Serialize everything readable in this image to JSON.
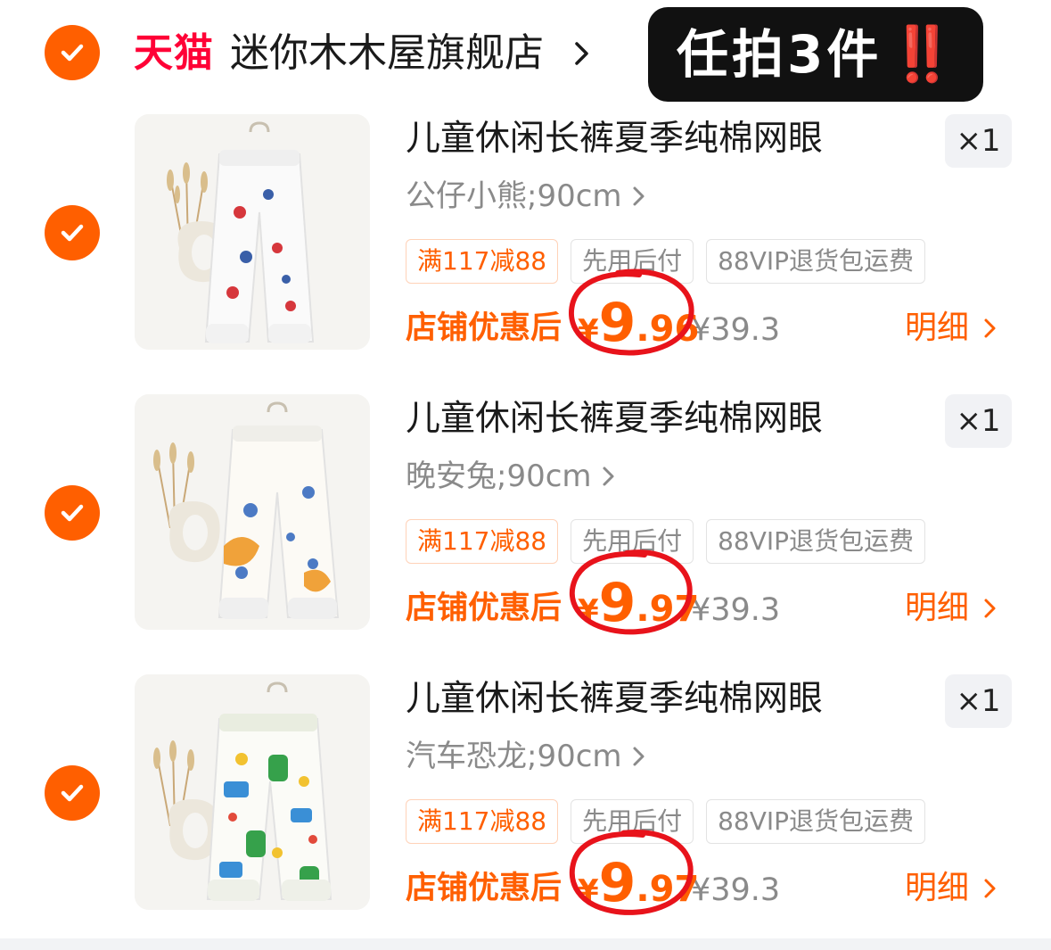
{
  "store": {
    "platform_label": "天猫",
    "name": "迷你木木屋旗舰店",
    "banner_text": "任拍3件",
    "banner_mark": "‼️"
  },
  "items": [
    {
      "title": "儿童休闲长裤夏季纯棉网眼",
      "sku": "公仔小熊;90cm",
      "qty": "×1",
      "tags": [
        "满117减88",
        "先用后付",
        "88VIP退货包运费"
      ],
      "price_label": "店铺优惠后",
      "price_yen": "¥",
      "price_int": "9",
      "price_dec": ".96",
      "orig_price": "¥39.3",
      "detail_label": "明细"
    },
    {
      "title": "儿童休闲长裤夏季纯棉网眼",
      "sku": "晚安兔;90cm",
      "qty": "×1",
      "tags": [
        "满117减88",
        "先用后付",
        "88VIP退货包运费"
      ],
      "price_label": "店铺优惠后",
      "price_yen": "¥",
      "price_int": "9",
      "price_dec": ".97",
      "orig_price": "¥39.3",
      "detail_label": "明细"
    },
    {
      "title": "儿童休闲长裤夏季纯棉网眼",
      "sku": "汽车恐龙;90cm",
      "qty": "×1",
      "tags": [
        "满117减88",
        "先用后付",
        "88VIP退货包运费"
      ],
      "price_label": "店铺优惠后",
      "price_yen": "¥",
      "price_int": "9",
      "price_dec": ".97",
      "orig_price": "¥39.3",
      "detail_label": "明细"
    }
  ],
  "colors": {
    "accent": "#ff5f00",
    "tmall_red": "#ff0036",
    "annotation_red": "#e8131b"
  }
}
